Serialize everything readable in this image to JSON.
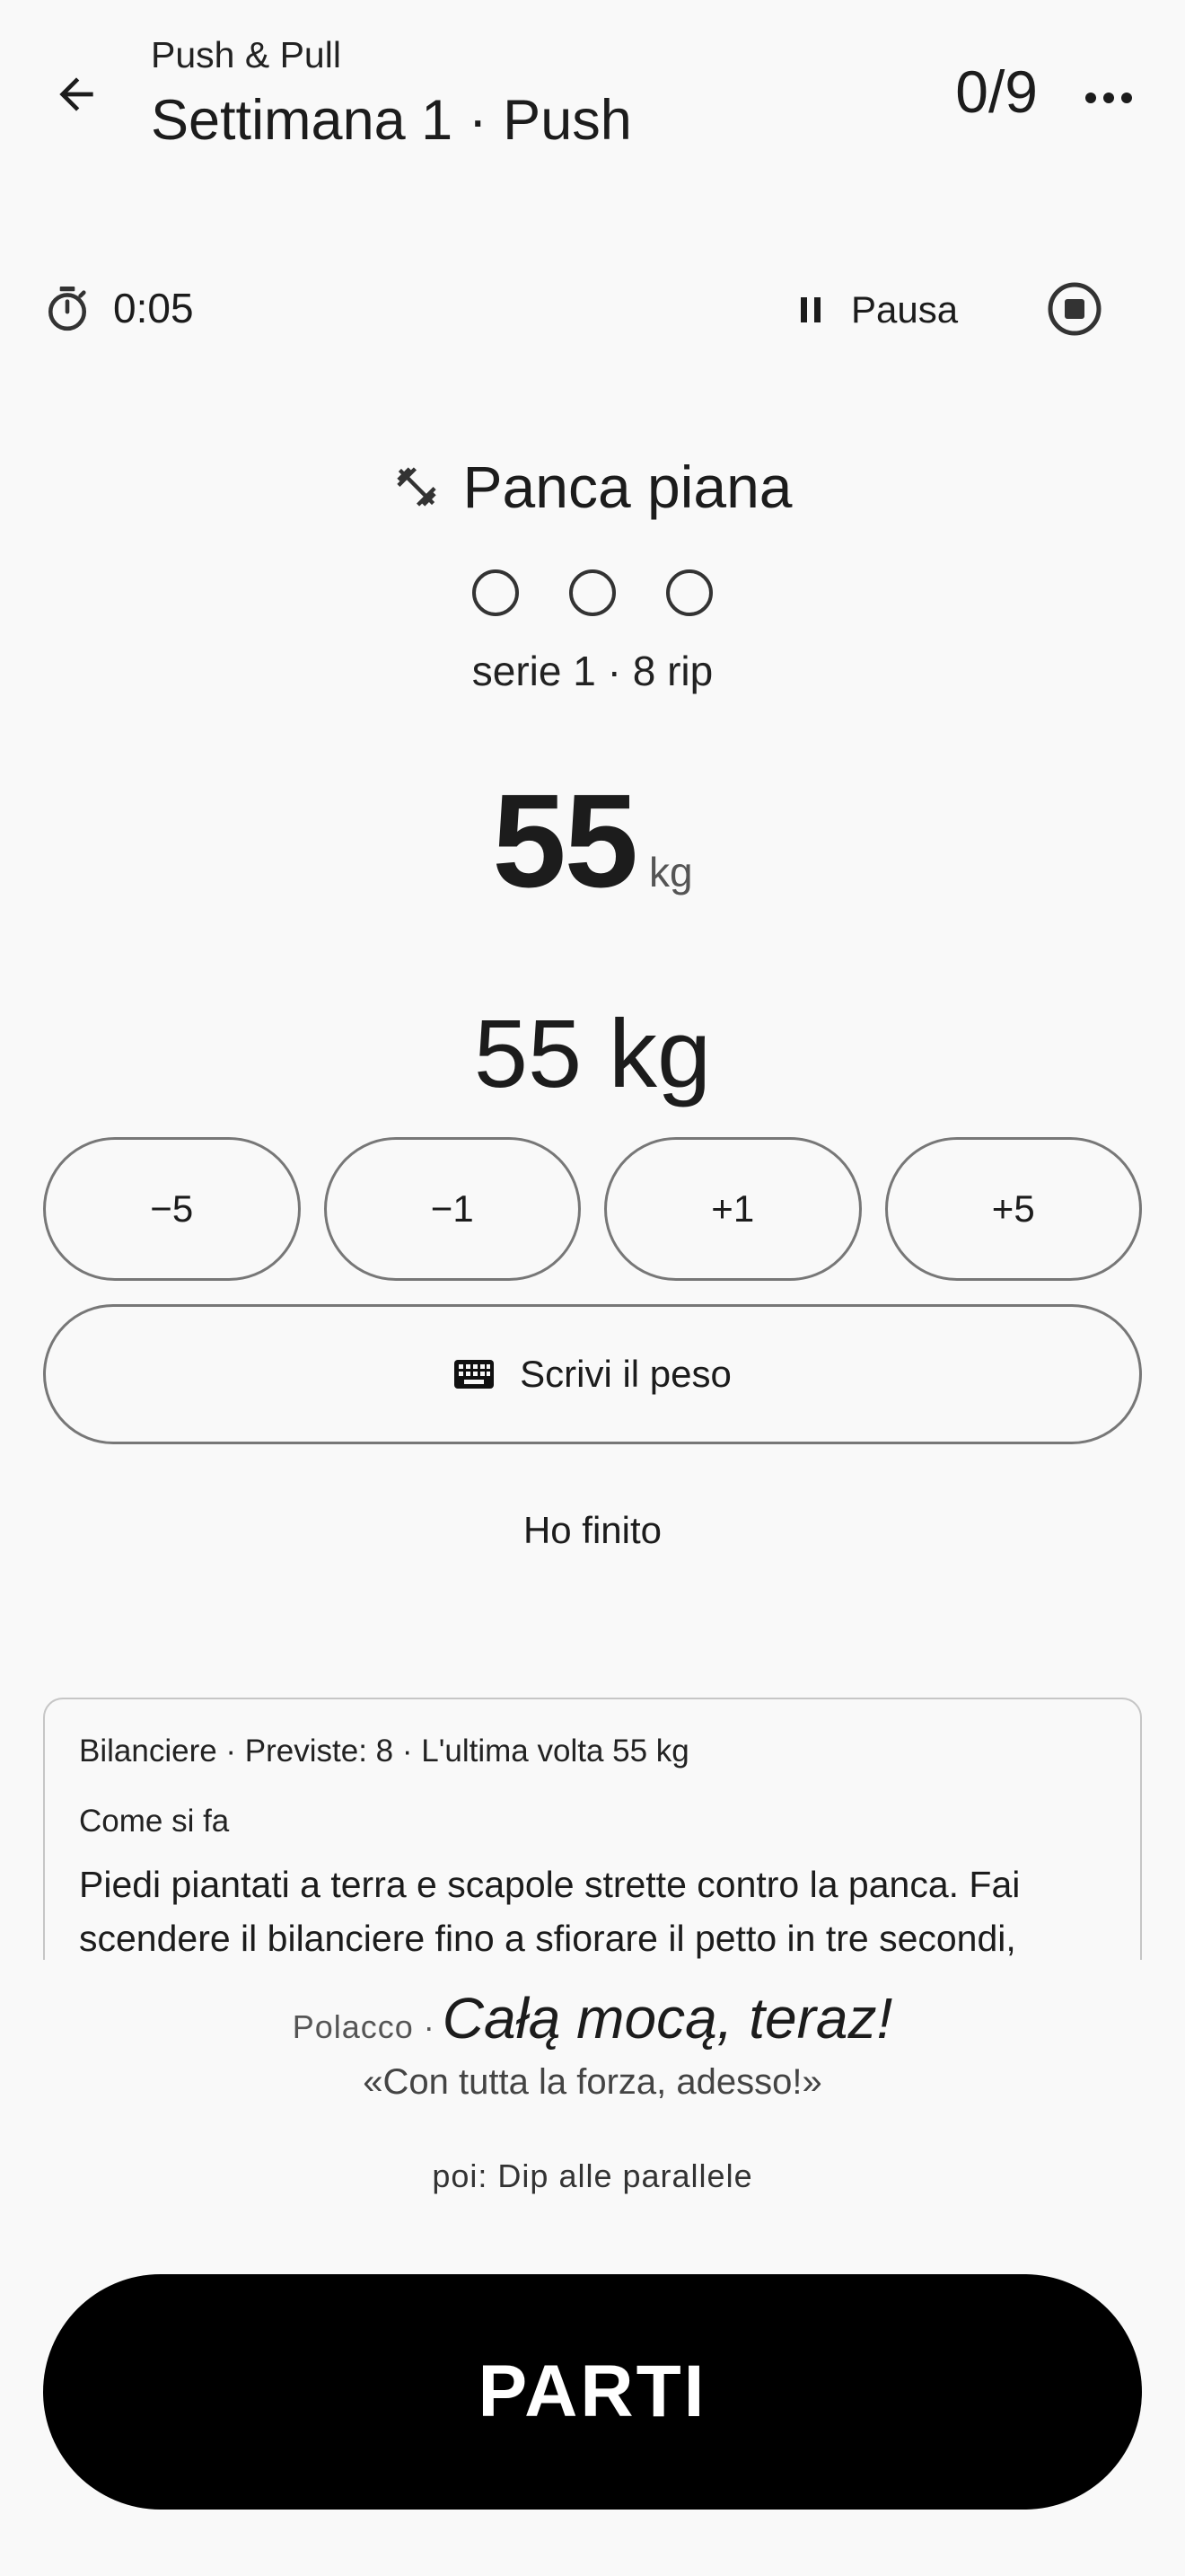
{
  "header": {
    "subtitle": "Push & Pull",
    "title": "Settimana 1 · Push",
    "progress": "0/9",
    "back_icon": "arrow-left-icon",
    "more_icon": "more-horizontal-icon"
  },
  "timer": {
    "elapsed": "0:05",
    "pause_label": "Pausa",
    "icons": [
      "stopwatch-icon",
      "pause-icon",
      "stop-circle-icon"
    ]
  },
  "exercise": {
    "name": "Panca piana",
    "icon": "dumbbell-icon",
    "sets_total": 3,
    "sets_done": 0,
    "set_info": "serie 1 · 8 rip",
    "weight_value": "55",
    "weight_unit": "kg",
    "weight_display": "55 kg"
  },
  "stepper": {
    "buttons": [
      "−5",
      "−1",
      "+1",
      "+5"
    ],
    "type_label": "Scrivi il peso",
    "type_icon": "keyboard-icon"
  },
  "done_label": "Ho finito",
  "info": {
    "meta": "Bilanciere · Previste: 8 · L'ultima volta 55 kg",
    "how_title": "Come si fa",
    "description": "Piedi piantati a terra e scapole strette contro la panca. Fai scendere il bilanciere fino a sfiorare il petto in tre secondi,"
  },
  "phrase": {
    "language": "Polacco ·",
    "text": "Całą mocą, teraz!",
    "translation": "«Con tutta la forza, adesso!»"
  },
  "next_exercise": "poi: Dip alle parallele",
  "start_label": "PARTI",
  "colors": {
    "background": "#f9f9f9",
    "primary_button": "#000000",
    "text": "#1c1c1c",
    "outline": "#777777"
  }
}
